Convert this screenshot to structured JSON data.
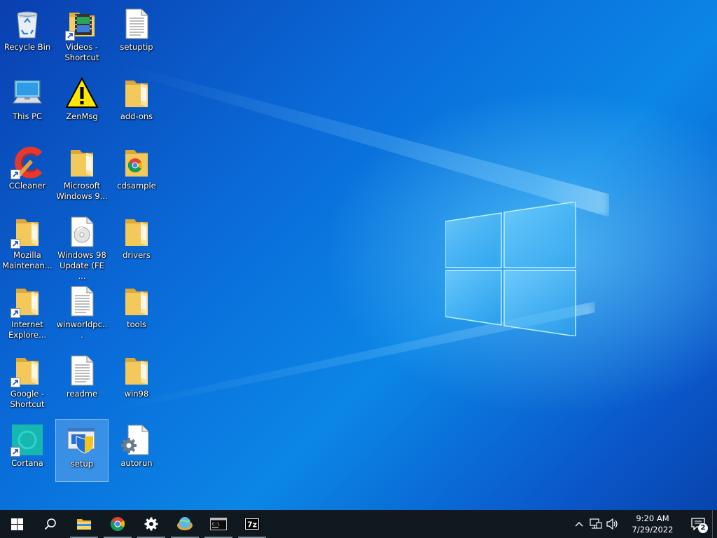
{
  "desktop": {
    "icons": [
      {
        "label": "Recycle Bin",
        "icon": "recycle-bin-icon"
      },
      {
        "label": "Videos - Shortcut",
        "icon": "videos-folder-icon"
      },
      {
        "label": "setuptip",
        "icon": "text-file-icon"
      },
      {
        "label": "This PC",
        "icon": "this-pc-icon"
      },
      {
        "label": "ZenMsg",
        "icon": "warning-icon"
      },
      {
        "label": "add-ons",
        "icon": "folder-icon"
      },
      {
        "label": "CCleaner",
        "icon": "ccleaner-icon"
      },
      {
        "label": "Microsoft Windows 9...",
        "icon": "folder-icon"
      },
      {
        "label": "cdsample",
        "icon": "chrome-folder-icon"
      },
      {
        "label": "Mozilla Maintenan...",
        "icon": "folder-icon"
      },
      {
        "label": "Windows 98 Update (FE ...",
        "icon": "disc-file-icon"
      },
      {
        "label": "drivers",
        "icon": "folder-icon"
      },
      {
        "label": "Internet Explore...",
        "icon": "folder-icon"
      },
      {
        "label": "winworldpc...",
        "icon": "text-file-icon"
      },
      {
        "label": "tools",
        "icon": "folder-icon"
      },
      {
        "label": "Google - Shortcut",
        "icon": "folder-icon"
      },
      {
        "label": "readme",
        "icon": "text-file-icon"
      },
      {
        "label": "win98",
        "icon": "folder-icon"
      },
      {
        "label": "Cortana",
        "icon": "cortana-icon"
      },
      {
        "label": "setup",
        "icon": "setup-icon"
      },
      {
        "label": "autorun",
        "icon": "settings-file-icon"
      }
    ]
  },
  "taskbar": {
    "buttons": [
      {
        "name": "start-button",
        "icon": "windows-logo-icon"
      },
      {
        "name": "search-button",
        "icon": "search-icon"
      },
      {
        "name": "file-explorer-button",
        "icon": "folder-icon"
      },
      {
        "name": "chrome-button",
        "icon": "chrome-icon"
      },
      {
        "name": "settings-button",
        "icon": "gear-icon"
      },
      {
        "name": "network-app-button",
        "icon": "globe-icon"
      },
      {
        "name": "command-prompt-button",
        "icon": "terminal-icon"
      },
      {
        "name": "7zip-button",
        "icon": "7zip-icon"
      }
    ],
    "sevenzip_label": "7z",
    "clock": {
      "time": "9:20 AM",
      "date": "7/29/2022"
    },
    "notification_count": "2"
  }
}
